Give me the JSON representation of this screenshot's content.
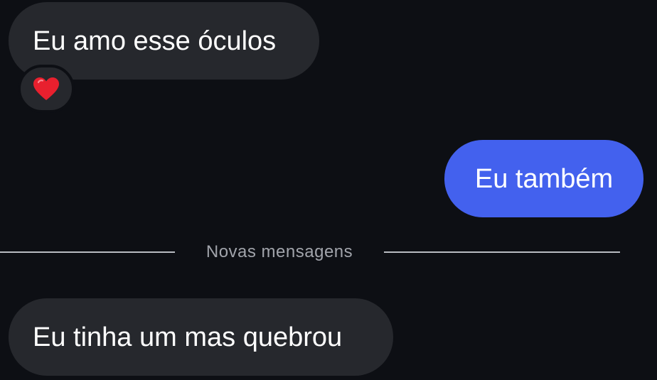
{
  "messages": [
    {
      "id": "msg1",
      "direction": "incoming",
      "text": "Eu amo esse óculos",
      "reaction": "heart"
    },
    {
      "id": "msg2",
      "direction": "outgoing",
      "text": "Eu também"
    },
    {
      "id": "msg3",
      "direction": "incoming",
      "text": "Eu tinha um mas quebrou"
    }
  ],
  "divider": {
    "label": "Novas mensagens"
  },
  "reaction_icon": "heart-icon",
  "colors": {
    "background": "#0d0f14",
    "incoming_bubble": "#26282d",
    "outgoing_bubble": "#4361ee",
    "text": "#ffffff",
    "divider": "#a1a4ab",
    "heart": "#e8202e"
  }
}
